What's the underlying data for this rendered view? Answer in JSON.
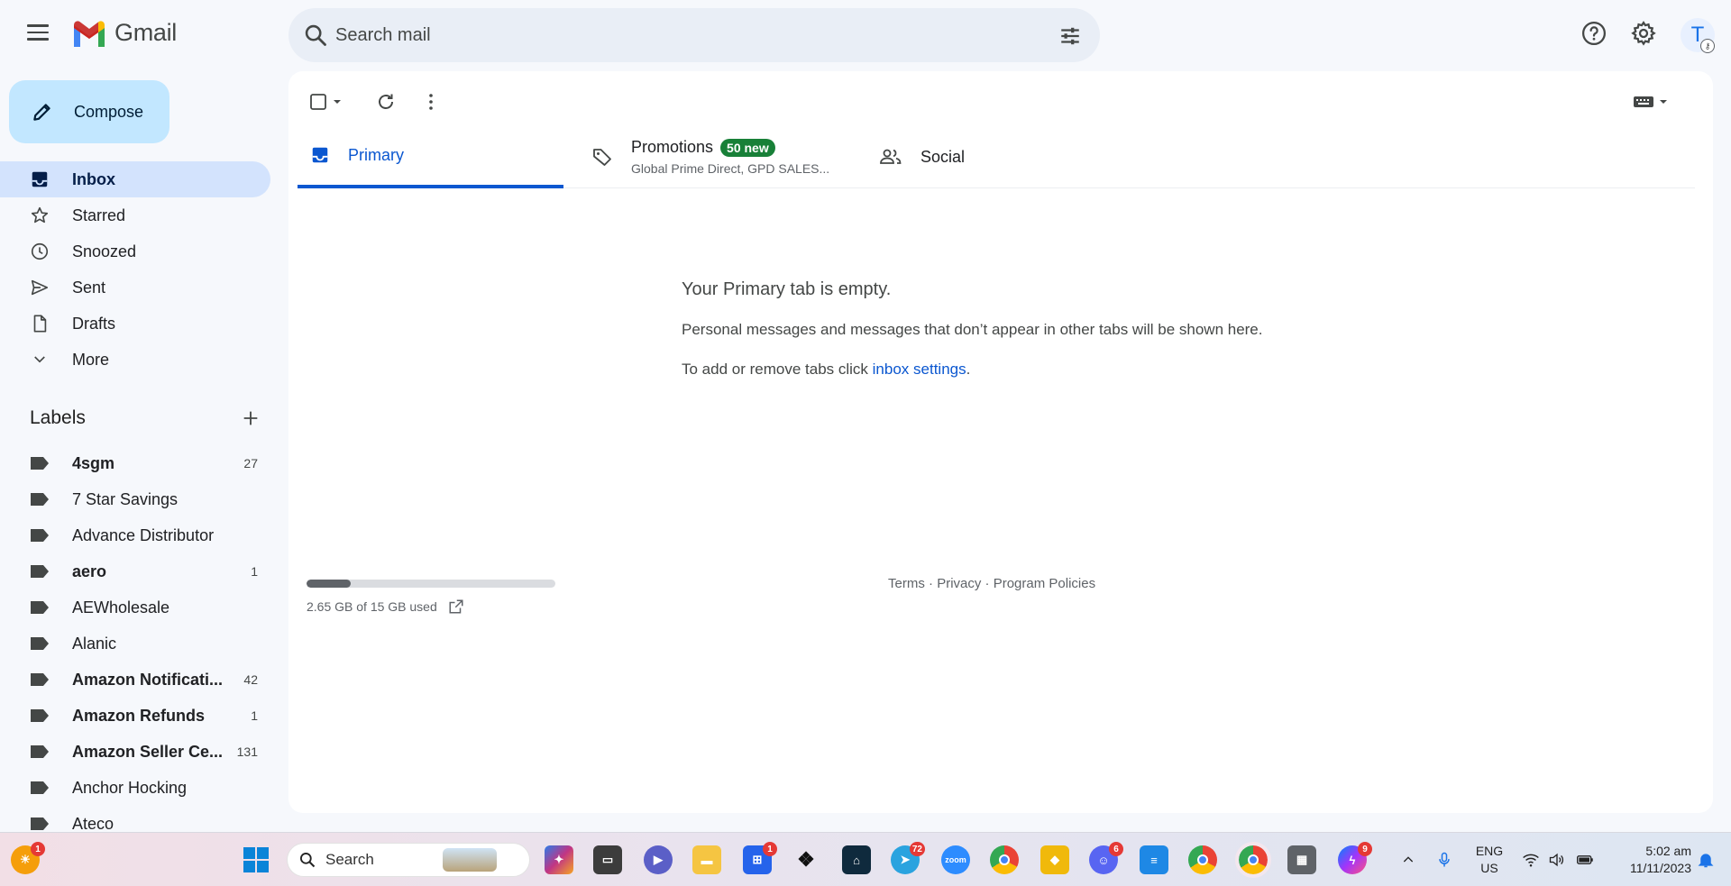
{
  "app": {
    "name": "Gmail"
  },
  "search": {
    "placeholder": "Search mail"
  },
  "account": {
    "initial": "T"
  },
  "compose": {
    "label": "Compose"
  },
  "nav": [
    {
      "label": "Inbox",
      "icon": "inbox-icon",
      "active": true
    },
    {
      "label": "Starred",
      "icon": "star-icon"
    },
    {
      "label": "Snoozed",
      "icon": "clock-icon"
    },
    {
      "label": "Sent",
      "icon": "send-icon"
    },
    {
      "label": "Drafts",
      "icon": "draft-icon"
    },
    {
      "label": "More",
      "icon": "chevron-down-icon"
    }
  ],
  "labels": {
    "heading": "Labels",
    "items": [
      {
        "name": "4sgm",
        "count": "27",
        "bold": true
      },
      {
        "name": "7 Star Savings",
        "count": "",
        "bold": false
      },
      {
        "name": "Advance Distributor",
        "count": "",
        "bold": false
      },
      {
        "name": "aero",
        "count": "1",
        "bold": true
      },
      {
        "name": "AEWholesale",
        "count": "",
        "bold": false
      },
      {
        "name": "Alanic",
        "count": "",
        "bold": false
      },
      {
        "name": "Amazon Notificati...",
        "count": "42",
        "bold": true
      },
      {
        "name": "Amazon Refunds",
        "count": "1",
        "bold": true
      },
      {
        "name": "Amazon Seller Ce...",
        "count": "131",
        "bold": true
      },
      {
        "name": "Anchor Hocking",
        "count": "",
        "bold": false
      },
      {
        "name": "Ateco",
        "count": "",
        "bold": false
      }
    ]
  },
  "tabs": {
    "primary": {
      "label": "Primary"
    },
    "promotions": {
      "label": "Promotions",
      "badge": "50 new",
      "snippet": "Global Prime Direct, GPD SALES..."
    },
    "social": {
      "label": "Social"
    }
  },
  "empty": {
    "title": "Your Primary tab is empty.",
    "description": "Personal messages and messages that don’t appear in other tabs will be shown here.",
    "tip_prefix": "To add or remove tabs click ",
    "tip_link": "inbox settings",
    "tip_suffix": "."
  },
  "storage": {
    "used_text": "2.65 GB of 15 GB used",
    "used_fraction": 0.177
  },
  "footer": {
    "terms": "Terms",
    "privacy": "Privacy",
    "policies": "Program Policies",
    "sep": " · "
  },
  "taskbar": {
    "search_placeholder": "Search",
    "weather_badge": "1",
    "store_badge": "1",
    "telegram_badge": "72",
    "discord_badge": "6",
    "messenger_badge": "9",
    "lang_line1": "ENG",
    "lang_line2": "US",
    "time": "5:02 am",
    "date": "11/11/2023",
    "colors": {
      "accent": "#0b57d0",
      "badge": "#e53935"
    }
  }
}
